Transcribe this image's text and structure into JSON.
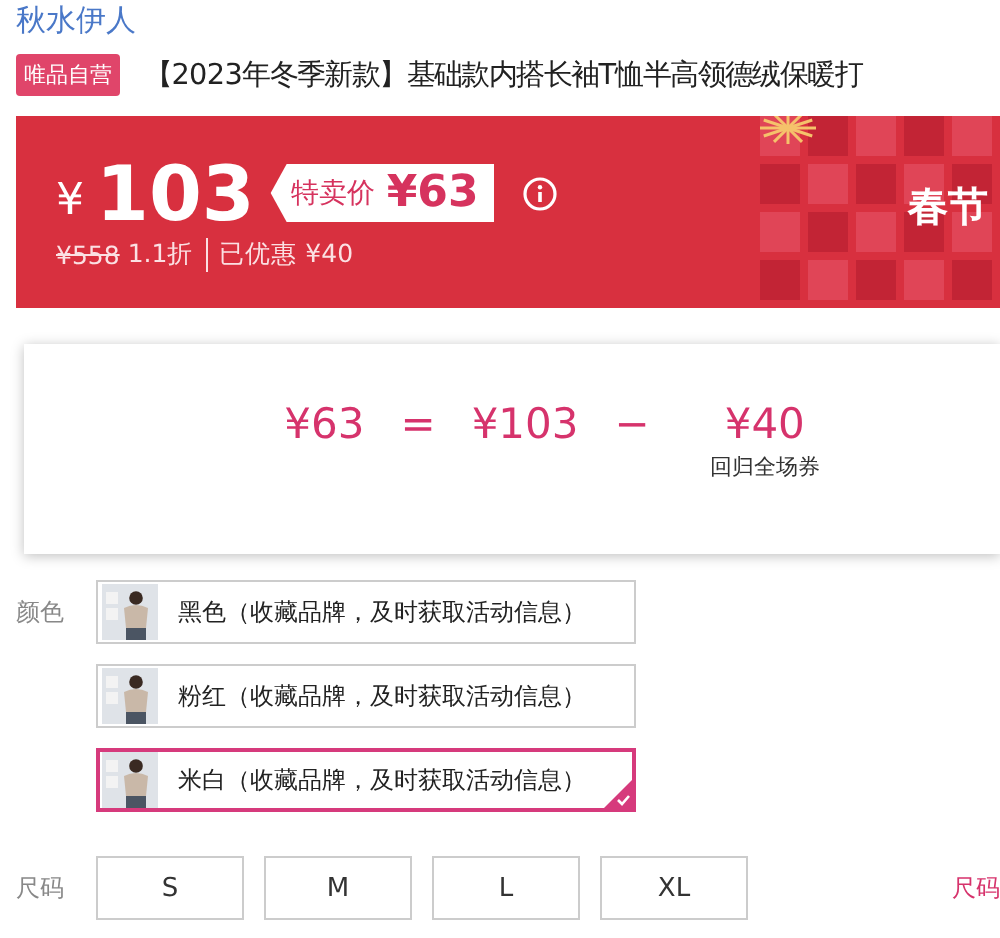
{
  "brand": "秋水伊人",
  "badge": "唯品自营",
  "title": "【2023年冬季新款】基础款内搭长袖T恤半高领德绒保暖打",
  "price": {
    "currency": "¥",
    "value": "103",
    "special_label": "特卖价",
    "special_price": "¥63",
    "original": "¥558",
    "discount": "1.1折",
    "saved": "已优惠 ¥40",
    "promo": "春节"
  },
  "popup": {
    "result": "¥63",
    "equals": "=",
    "base": "¥103",
    "minus": "−",
    "coupon": "¥40",
    "coupon_label": "回归全场券"
  },
  "color": {
    "label": "颜色",
    "options": [
      {
        "text": "黑色（收藏品牌，及时获取活动信息）",
        "selected": false
      },
      {
        "text": "粉红（收藏品牌，及时获取活动信息）",
        "selected": false
      },
      {
        "text": "米白（收藏品牌，及时获取活动信息）",
        "selected": true
      }
    ]
  },
  "size": {
    "label": "尺码",
    "options": [
      {
        "text": "S",
        "selected": false
      },
      {
        "text": "M",
        "selected": false
      },
      {
        "text": "L",
        "selected": false
      },
      {
        "text": "XL",
        "selected": false
      }
    ],
    "guide": "尺码"
  }
}
